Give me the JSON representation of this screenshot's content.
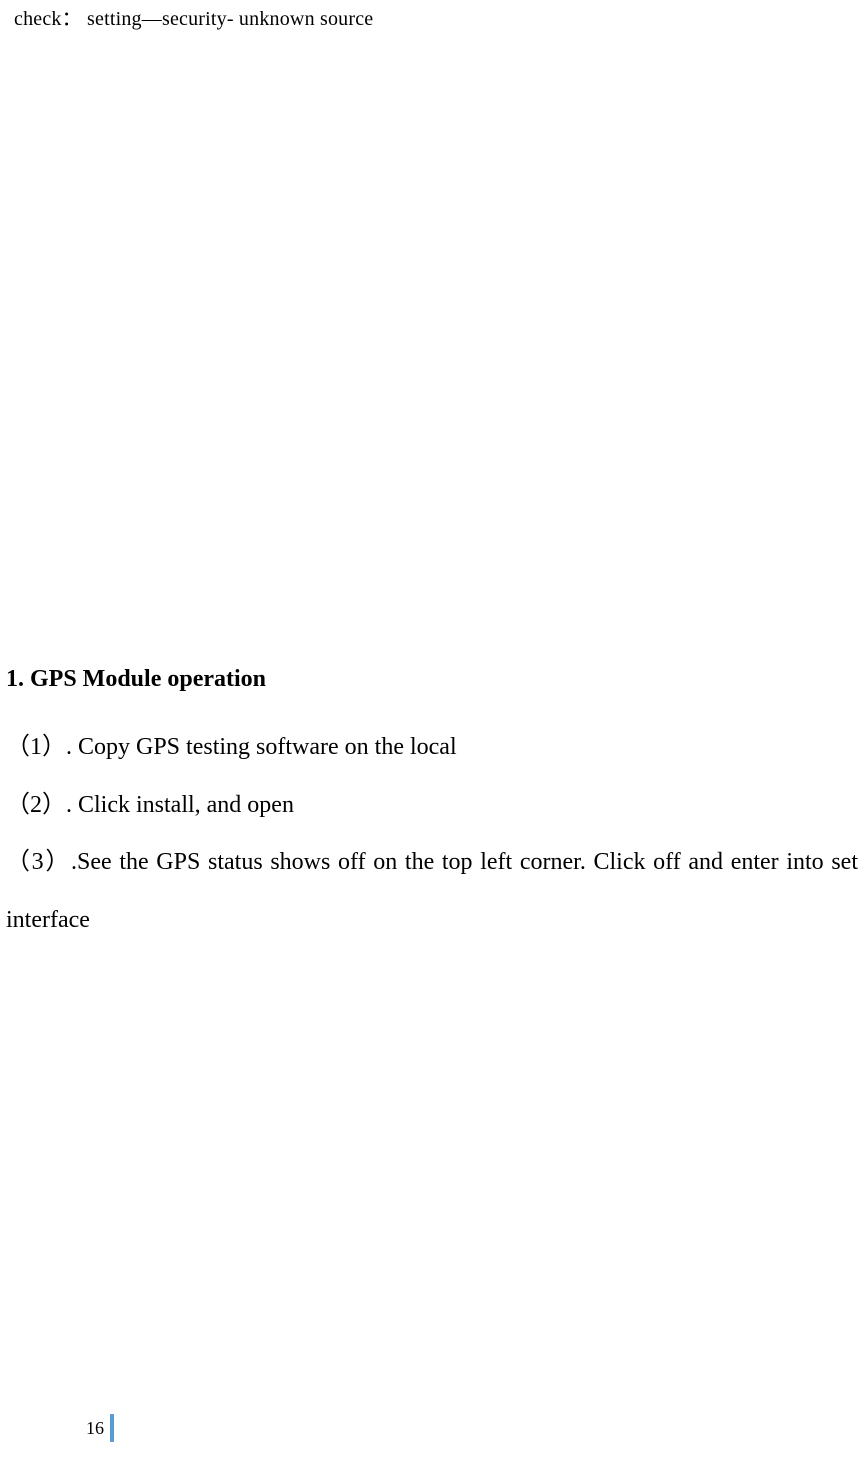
{
  "top_note": "check：  setting—security- unknown source",
  "heading": "1. GPS Module operation",
  "items": [
    "（1）. Copy GPS testing software on the local",
    "（2）. Click install, and open",
    "（3）.See the GPS status shows off on the top left corner. Click off and enter into set interface"
  ],
  "page_number": "16"
}
